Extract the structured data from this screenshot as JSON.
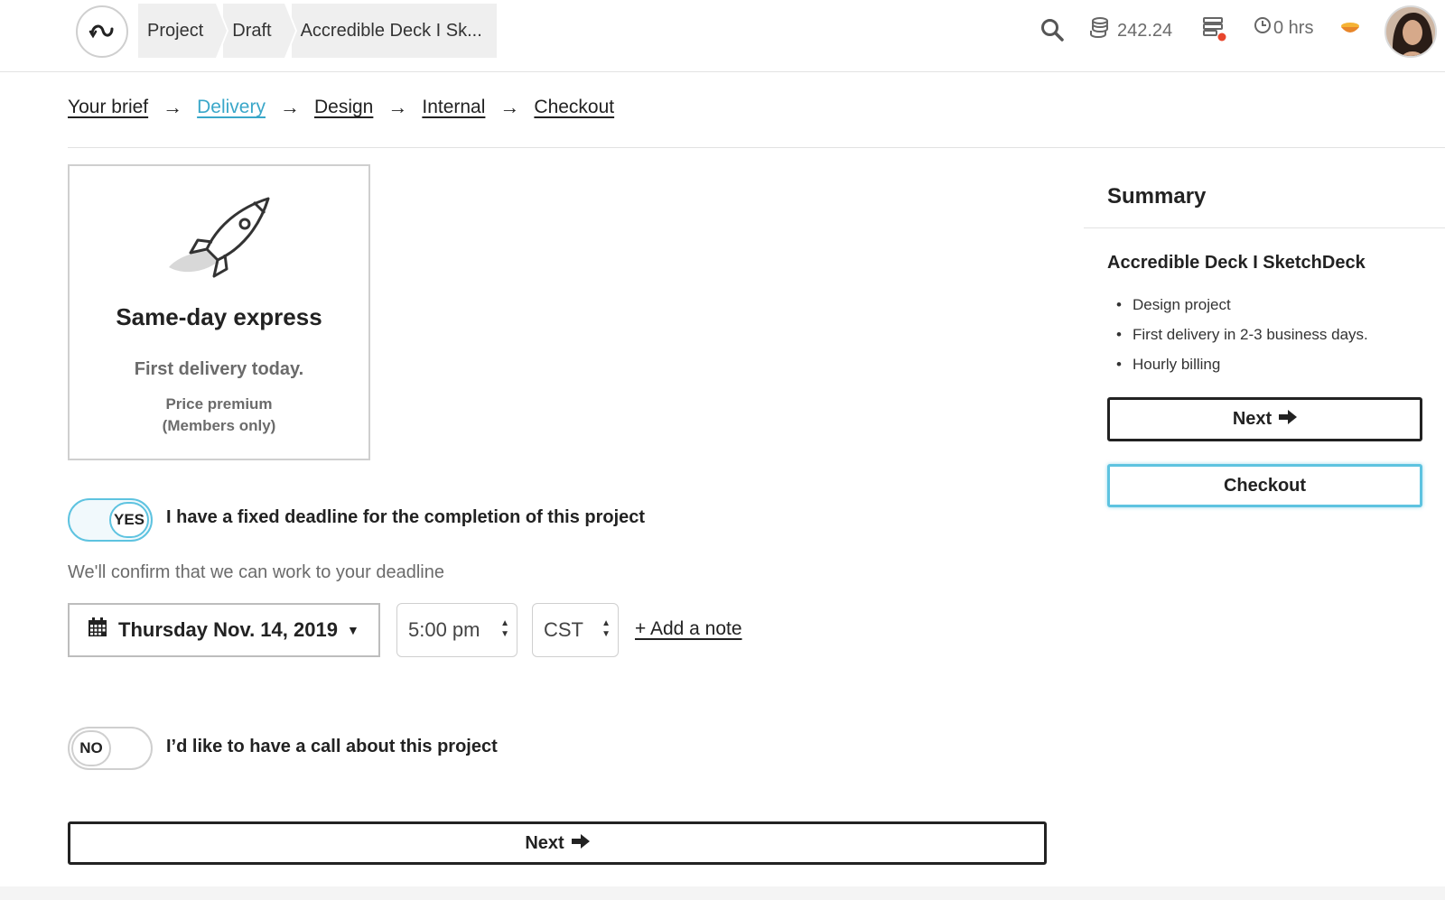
{
  "breadcrumb": {
    "items": [
      "Project",
      "Draft",
      "Accredible Deck I Sk..."
    ]
  },
  "header": {
    "credits": "242.24",
    "hours": "0 hrs",
    "icons": [
      "search-icon",
      "coins-icon",
      "tasks-icon",
      "clock-icon",
      "bowl-icon"
    ]
  },
  "steps": {
    "items": [
      {
        "label": "Your brief",
        "active": false
      },
      {
        "label": "Delivery",
        "active": true
      },
      {
        "label": "Design",
        "active": false
      },
      {
        "label": "Internal",
        "active": false
      },
      {
        "label": "Checkout",
        "active": false
      }
    ],
    "arrow": "→"
  },
  "delivery_option": {
    "title": "Same-day express",
    "subtitle": "First delivery today.",
    "price_line1": "Price premium",
    "price_line2": "(Members only)"
  },
  "deadline": {
    "toggle_state": "YES",
    "label": "I have a fixed deadline for the completion of this project",
    "confirm_text": "We'll confirm that we can work to your deadline",
    "date": "Thursday Nov. 14, 2019",
    "time": "5:00 pm",
    "timezone": "CST",
    "add_note": "+ Add a note"
  },
  "call": {
    "toggle_state": "NO",
    "label": "I’d like to have a call about this project"
  },
  "main": {
    "next_label": "Next"
  },
  "summary": {
    "title": "Summary",
    "project_name": "Accredible Deck I SketchDeck",
    "items": [
      "Design project",
      "First delivery in 2-3 business days.",
      "Hourly billing"
    ],
    "next_label": "Next",
    "checkout_label": "Checkout"
  },
  "colors": {
    "accent": "#3aa7c9",
    "toggle_on": "#5ec3e0",
    "text": "#222222",
    "muted": "#6b6b6b"
  }
}
